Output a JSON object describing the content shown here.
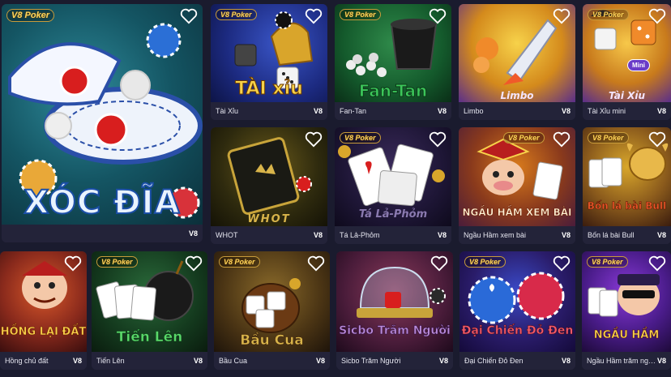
{
  "provider": "V8",
  "brand_logo": "V8 Poker",
  "games": [
    {
      "name": "",
      "art_title": "XÓC ĐĨA"
    },
    {
      "name": "Tài Xỉu",
      "art_title": "TÀI xỉu"
    },
    {
      "name": "Fan-Tan",
      "art_title": "Fan-Tan"
    },
    {
      "name": "Limbo",
      "art_title": "Limbo"
    },
    {
      "name": "Tài Xỉu mini",
      "art_title": "Tài Xỉu",
      "badge": "Mini"
    },
    {
      "name": "WHOT",
      "art_title": "WHOT"
    },
    {
      "name": "Tá Lả-Phỏm",
      "art_title": "Tá Lả-Phỏm"
    },
    {
      "name": "Ngầu Hầm xem bài",
      "art_title": "NGẦU HẦM XEM BÀI"
    },
    {
      "name": "Bốn lá bài Bull",
      "art_title": "Bốn lá bài Bull"
    },
    {
      "name": "Hồng chủ đất",
      "art_title": "HỒNG LẠI ĐẤT"
    },
    {
      "name": "Tiến Lên",
      "art_title": "Tiến Lên"
    },
    {
      "name": "Bầu Cua",
      "art_title": "Bầu Cua"
    },
    {
      "name": "Sicbo Trăm Người",
      "art_title": "Sicbo Trăm Người"
    },
    {
      "name": "Đại Chiến Đỏ Đen",
      "art_title": "Đại Chiến Đỏ Đen"
    },
    {
      "name": "Ngầu Hầm trăm người",
      "art_title": "NGẦU HẦM"
    }
  ],
  "colors": {
    "background": "#1a1b2e",
    "footer": "#232339",
    "heart": "#ffffff"
  },
  "icons": {
    "favorite": "heart-outline-icon"
  }
}
